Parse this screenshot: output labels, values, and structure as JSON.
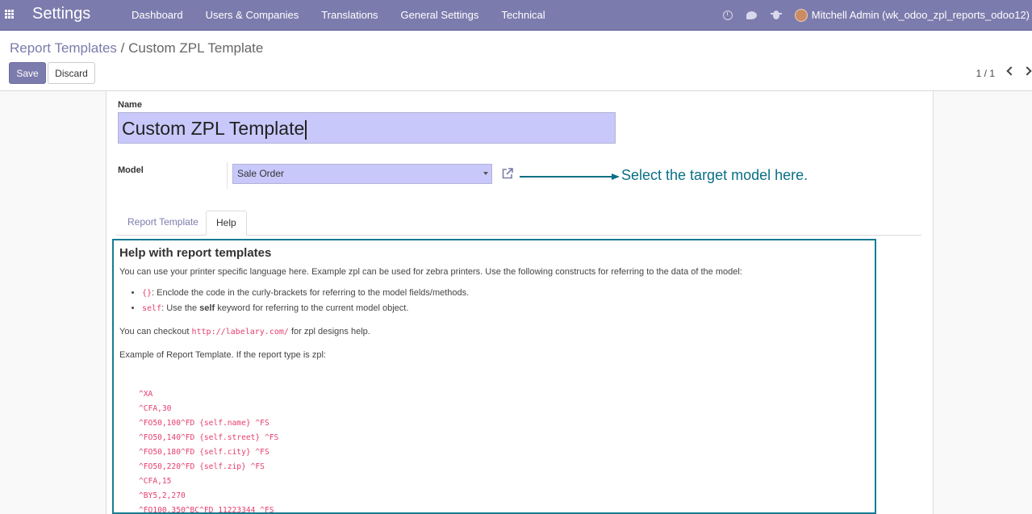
{
  "navbar": {
    "brand": "Settings",
    "menu": [
      "Dashboard",
      "Users & Companies",
      "Translations",
      "General Settings",
      "Technical"
    ],
    "user_name": "Mitchell Admin (wk_odoo_zpl_reports_odoo12)",
    "colors": {
      "bar": "#7c7bad"
    },
    "icons": [
      "apps-icon",
      "clock-icon",
      "chat-icon",
      "bug-icon"
    ]
  },
  "control": {
    "breadcrumb_parent": "Report Templates",
    "breadcrumb_separator": "/",
    "breadcrumb_current": "Custom ZPL Template",
    "save_label": "Save",
    "discard_label": "Discard",
    "pager": "1 / 1"
  },
  "form": {
    "name_label": "Name",
    "name_value": "Custom ZPL Template",
    "model_label": "Model",
    "model_value": "Sale Order",
    "annotation": "Select the target model here."
  },
  "tabs": {
    "report_template": "Report Template",
    "help": "Help",
    "active": "Help"
  },
  "help": {
    "title": "Help with report templates",
    "intro": "You can use your printer specific language here. Example zpl can be used for zebra printers. Use the following constructs for referring to the data of the model:",
    "items": [
      {
        "code": "{}",
        "text": ": Enclode the code in the curly-brackets for referring to the model fields/methods."
      },
      {
        "code": "self",
        "text_before": ": Use the ",
        "bold": "self",
        "text_after": " keyword for referring to the current model object."
      }
    ],
    "checkout_before": "You can checkout ",
    "checkout_link": "http://labelary.com/",
    "checkout_after": " for zpl designs help.",
    "example_intro": "Example of Report Template. If the report type is zpl:",
    "code_lines": [
      "^XA",
      "^CFA,30",
      "^FO50,100^FD {self.name} ^FS",
      "^FO50,140^FD {self.street} ^FS",
      "^FO50,180^FD {self.city} ^FS",
      "^FO50,220^FD {self.zip} ^FS",
      "^CFA,15",
      "^BY5,2,270",
      "^FO100,350^BC^FD 11223344 ^FS"
    ]
  }
}
